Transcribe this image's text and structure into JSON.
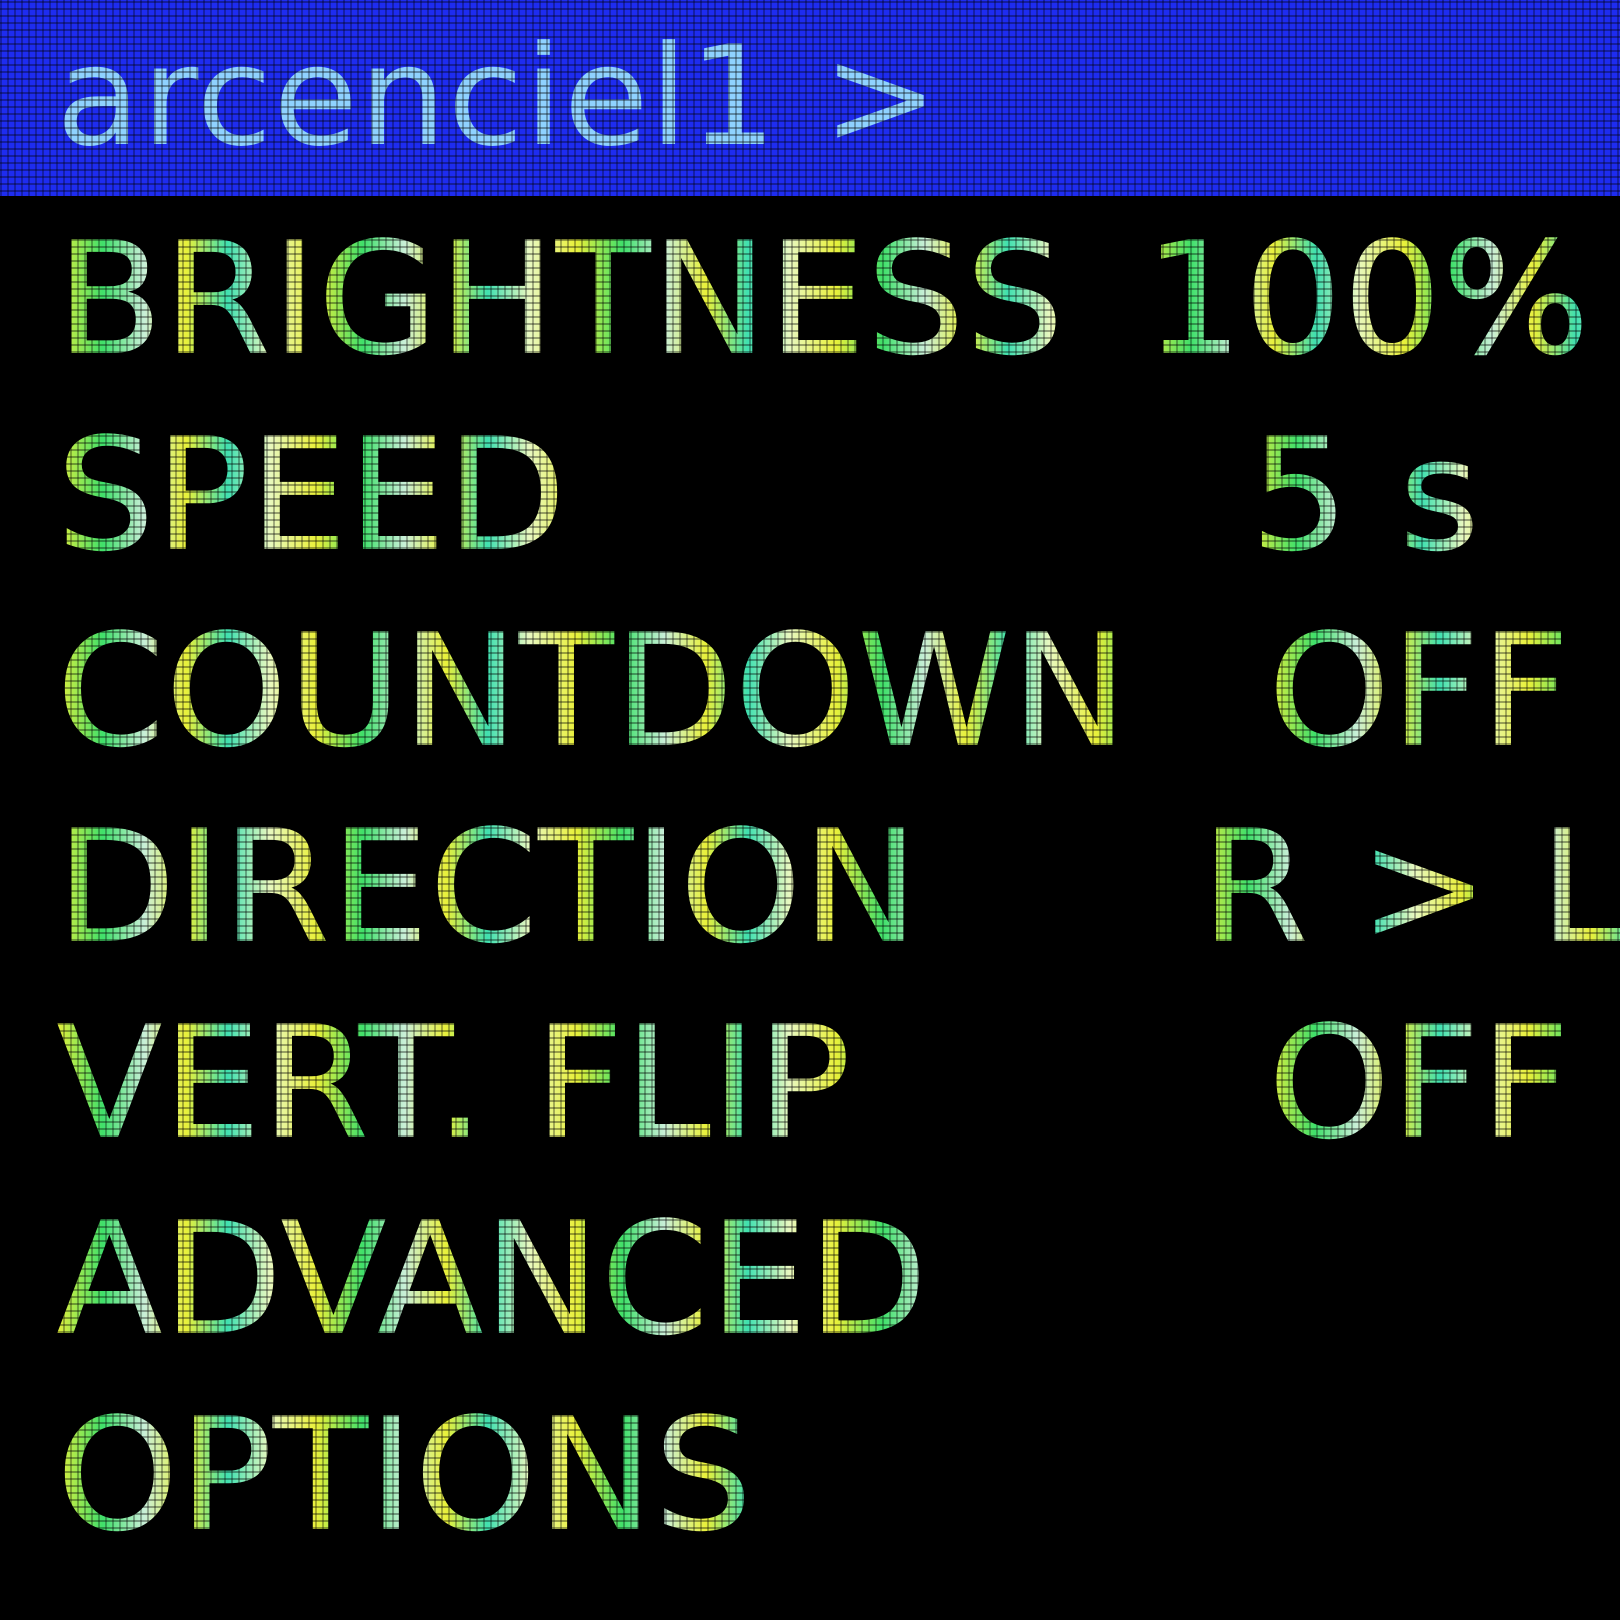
{
  "header": {
    "title": "arcenciel1 >",
    "background_color": "#1e2cf0",
    "text_color": "#8fd2ff"
  },
  "menu": {
    "items": [
      {
        "label": "BRIGHTNESS",
        "value": "100%"
      },
      {
        "label": "SPEED",
        "value": "5 s"
      },
      {
        "label": "COUNTDOWN",
        "value": "OFF"
      },
      {
        "label": "DIRECTION",
        "value": "R > L"
      },
      {
        "label": "VERT. FLIP",
        "value": "OFF"
      },
      {
        "label": "ADVANCED",
        "value": ""
      },
      {
        "label": "OPTIONS",
        "value": ""
      }
    ]
  },
  "colors": {
    "background": "#000000",
    "text_yellow": "#e9f03a",
    "text_green": "#3fe06a",
    "text_white": "#c9efd8"
  }
}
